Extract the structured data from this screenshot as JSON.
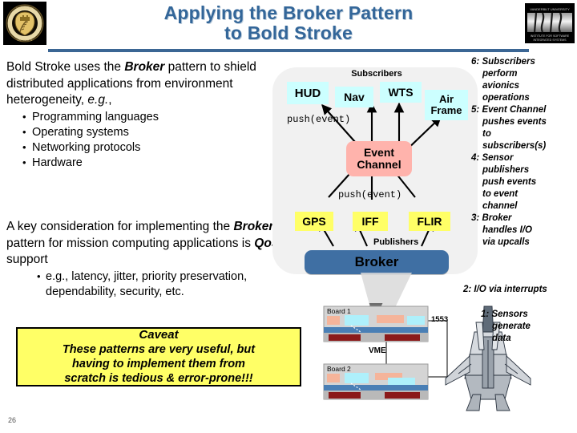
{
  "slide": {
    "page_number": "26",
    "title_line1": "Applying the Broker Pattern",
    "title_line2": "to Bold Stroke",
    "title_color": "#336699",
    "logo_left_name": "washington-university-seal",
    "logo_right_text": "ISIS"
  },
  "left": {
    "para1": {
      "t1": "Bold Stroke uses the ",
      "bold_italic": "Broker",
      "t2": " pattern to shield distributed applications from environment heterogeneity, ",
      "italic": "e.g.",
      "t3": ","
    },
    "bullets1": [
      "Programming languages",
      "Operating systems",
      "Networking protocols",
      "Hardware"
    ],
    "para2": {
      "t1": "A key consideration for implementing the ",
      "bold_italic": "Broker",
      "t2": " pattern for mission computing applications is ",
      "bold2": "QoS",
      "t3": " support"
    },
    "bullets2_line1": "e.g., latency, jitter, priority preservation,",
    "bullets2_line2": "dependability, security, etc."
  },
  "caveat": {
    "title": "Caveat",
    "line1": "These patterns are very useful, but",
    "line2": "having to implement them from",
    "line3": "scratch is tedious & error-prone!!!",
    "bg_color": "#ffff66"
  },
  "diagram": {
    "subscribers_label": "Subscribers",
    "publishers_label": "Publishers",
    "push_label_top": "push(event)",
    "push_label_bottom": "push(event)",
    "subscribers": [
      {
        "label": "HUD",
        "color": "#ccffff"
      },
      {
        "label": "Nav",
        "color": "#ccffff"
      },
      {
        "label": "WTS",
        "color": "#ccffff"
      },
      {
        "label": "Air Frame",
        "color": "#ccffff"
      }
    ],
    "event_channel": {
      "line1": "Event",
      "line2": "Channel",
      "color": "#ffb3ac"
    },
    "publishers": [
      {
        "label": "GPS",
        "color": "#ffff66"
      },
      {
        "label": "IFF",
        "color": "#ffff66"
      },
      {
        "label": "FLIR",
        "color": "#ffff66"
      }
    ],
    "broker": {
      "label": "Broker",
      "color": "#3f6fa3"
    }
  },
  "hardware": {
    "board1_label": "Board 1",
    "board2_label": "Board 2",
    "bus_label": "VME",
    "link_label": "1553",
    "aircraft_name": "fighter-jet-illustration"
  },
  "steps": [
    {
      "num": "6:",
      "head": "Subscribers",
      "rest": [
        "perform",
        "avionics",
        "operations"
      ]
    },
    {
      "num": "5:",
      "head": "Event Channel",
      "rest": [
        "pushes events",
        "to",
        "subscribers(s)"
      ]
    },
    {
      "num": "4:",
      "head": "Sensor",
      "rest": [
        "publishers",
        "push events",
        "to event",
        "channel"
      ]
    },
    {
      "num": "3:",
      "head": "Broker",
      "rest": [
        "handles I/O",
        "via upcalls"
      ]
    }
  ],
  "step2_text": "2: I/O via interrupts",
  "step1": {
    "num": "1:",
    "head": "Sensors",
    "rest": [
      "generate",
      "data"
    ]
  }
}
